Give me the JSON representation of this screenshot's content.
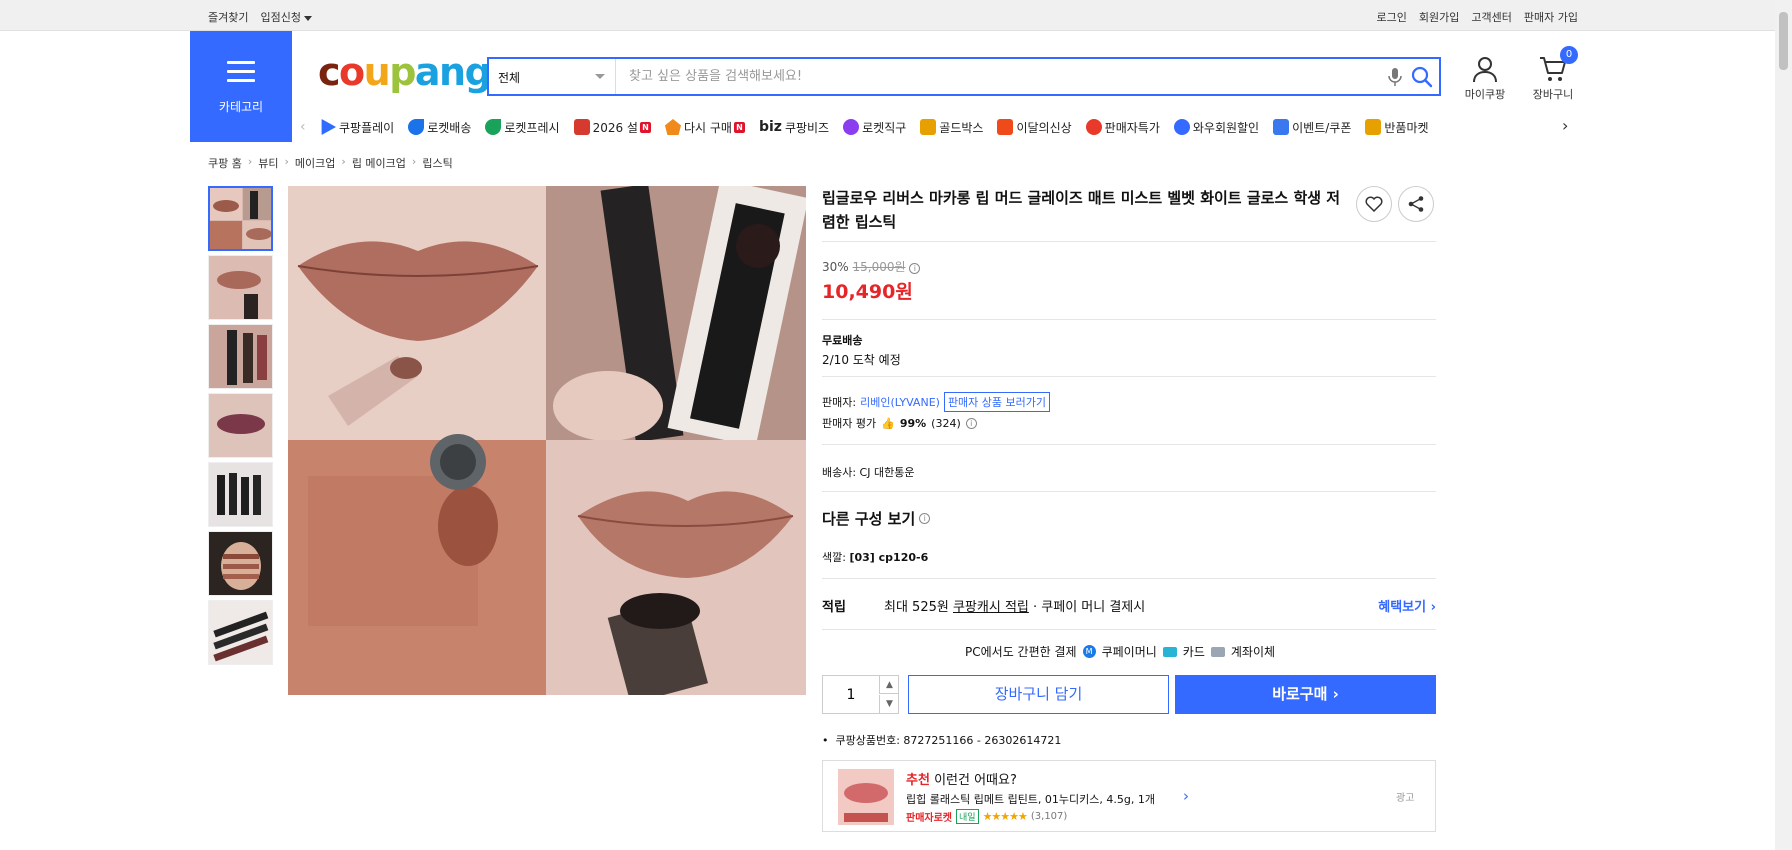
{
  "topbar": {
    "left": [
      "즐겨찾기",
      "입점신청"
    ],
    "right": [
      "로그인",
      "회원가입",
      "고객센터",
      "판매자 가입"
    ]
  },
  "header": {
    "category_label": "카테고리",
    "logo": [
      "c",
      "o",
      "u",
      "p",
      "ang"
    ],
    "search_select": "전체",
    "search_placeholder": "찾고 싶은 상품을 검색해보세요!",
    "mycoupang": "마이쿠팡",
    "cart": "장바구니",
    "cart_count": "0"
  },
  "nav": {
    "items": [
      {
        "label": "쿠팡플레이",
        "color": "#2f6bff"
      },
      {
        "label": "로켓배송",
        "color": "#1a73e8"
      },
      {
        "label": "로켓프레시",
        "color": "#19a35a"
      },
      {
        "label": "2026 설",
        "color": "#d63a2f",
        "badge": "N"
      },
      {
        "label": "다시 구매",
        "color": "#f08a1a",
        "badge": "N"
      },
      {
        "label": "쿠팡비즈",
        "prefix": "biz",
        "color": "#222"
      },
      {
        "label": "로켓직구",
        "color": "#8b3df0"
      },
      {
        "label": "골드박스",
        "color": "#e6a100"
      },
      {
        "label": "이달의신상",
        "color": "#f04a1a"
      },
      {
        "label": "판매자특가",
        "color": "#e8392a"
      },
      {
        "label": "와우회원할인",
        "color": "#346aff"
      },
      {
        "label": "이벤트/쿠폰",
        "color": "#3a78f0"
      },
      {
        "label": "반품마켓",
        "color": "#e6a100"
      }
    ]
  },
  "breadcrumb": [
    "쿠팡 홈",
    "뷰티",
    "메이크업",
    "립 메이크업",
    "립스틱"
  ],
  "product": {
    "title": "립글로우 리버스 마카롱 립 머드 글레이즈 매트 미스트 벨벳 화이트 글로스 학생 저렴한 립스틱",
    "discount_rate": "30%",
    "original_price": "15,000원",
    "price": "10,490원",
    "shipping_title": "무료배송",
    "shipping_eta": "2/10 도착 예정",
    "seller_label": "판매자:",
    "seller_name": "리베인(LYVANE)",
    "seller_link": "판매자 상품 보러가기",
    "seller_rating_label": "판매자 평가",
    "seller_rating": "99%",
    "seller_rating_count": "(324)",
    "carrier": "배송사:  CJ 대한통운",
    "options_title": "다른 구성 보기",
    "color_label": "색깔:",
    "color_value": "[03] cp120-6",
    "reward_label": "적립",
    "reward_text_1": "최대 525원",
    "reward_text_2": "쿠팡캐시 적립",
    "reward_text_3": "· 쿠페이 머니 결제시",
    "benefit_link": "혜택보기 ›",
    "pay_intro": "PC에서도 간편한 결제",
    "pay_methods": [
      "쿠페이머니",
      "카드",
      "계좌이체"
    ],
    "quantity": "1",
    "add_to_cart": "장바구니 담기",
    "buy_now": "바로구매 ›",
    "product_number": "쿠팡상품번호: 8727251166 - 26302614721"
  },
  "recommend": {
    "heading_accent": "추천",
    "heading_rest": "이런건 어때요?",
    "item": "립힙 롤래스틱 립메트 립틴트, 01누디키스, 4.5g, 1개",
    "tag1": "판매자로켓",
    "tag2": "내일",
    "reviews": "(3,107)",
    "rating": 4.5,
    "ad": "광고"
  }
}
